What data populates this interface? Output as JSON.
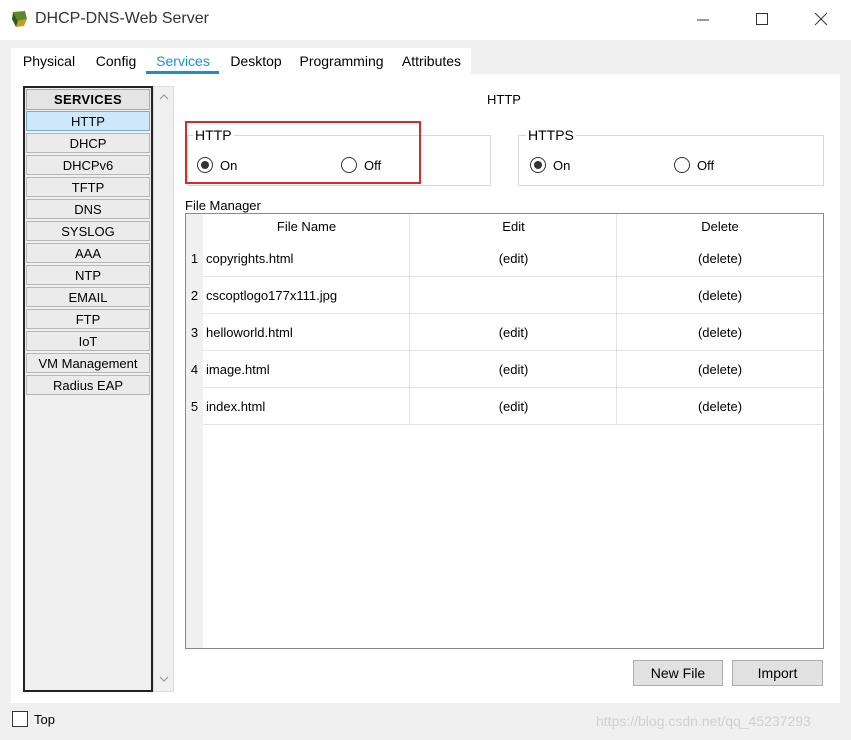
{
  "window": {
    "title": "DHCP-DNS-Web Server",
    "minimize_glyph": "—",
    "maximize_glyph": "☐",
    "close_glyph": "✕",
    "icon": "cisco-server-icon"
  },
  "tabs": [
    {
      "label": "Physical",
      "active": false
    },
    {
      "label": "Config",
      "active": false
    },
    {
      "label": "Services",
      "active": true
    },
    {
      "label": "Desktop",
      "active": false
    },
    {
      "label": "Programming",
      "active": false
    },
    {
      "label": "Attributes",
      "active": false
    }
  ],
  "sidebar": {
    "header": "SERVICES",
    "items": [
      {
        "label": "HTTP",
        "active": true
      },
      {
        "label": "DHCP"
      },
      {
        "label": "DHCPv6"
      },
      {
        "label": "TFTP"
      },
      {
        "label": "DNS"
      },
      {
        "label": "SYSLOG"
      },
      {
        "label": "AAA"
      },
      {
        "label": "NTP"
      },
      {
        "label": "EMAIL"
      },
      {
        "label": "FTP"
      },
      {
        "label": "IoT"
      },
      {
        "label": "VM Management"
      },
      {
        "label": "Radius EAP"
      }
    ]
  },
  "main": {
    "title": "HTTP",
    "http": {
      "label": "HTTP",
      "on_label": "On",
      "off_label": "Off",
      "selected": "On"
    },
    "https": {
      "label": "HTTPS",
      "on_label": "On",
      "off_label": "Off",
      "selected": "On"
    },
    "file_manager": {
      "label": "File Manager",
      "columns": [
        "File Name",
        "Edit",
        "Delete"
      ],
      "rows": [
        {
          "num": "1",
          "name": "copyrights.html",
          "edit": "(edit)",
          "delete": "(delete)"
        },
        {
          "num": "2",
          "name": "cscoptlogo177x111.jpg",
          "edit": "",
          "delete": "(delete)"
        },
        {
          "num": "3",
          "name": "helloworld.html",
          "edit": "(edit)",
          "delete": "(delete)"
        },
        {
          "num": "4",
          "name": "image.html",
          "edit": "(edit)",
          "delete": "(delete)"
        },
        {
          "num": "5",
          "name": "index.html",
          "edit": "(edit)",
          "delete": "(delete)"
        }
      ]
    },
    "buttons": {
      "new_file": "New File",
      "import": "Import"
    }
  },
  "footer": {
    "top_label": "Top",
    "top_checked": false,
    "watermark": "https://blog.csdn.net/qq_45237293"
  },
  "colors": {
    "accent": "#1d8fd0",
    "highlight_border": "#e0262a",
    "active_service_bg": "#cde8fb"
  }
}
